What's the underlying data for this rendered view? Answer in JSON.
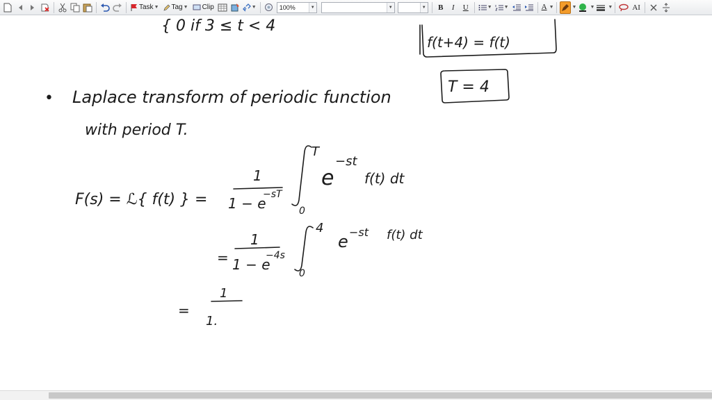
{
  "toolbar": {
    "task_label": "Task",
    "tag_label": "Tag",
    "clip_label": "Clip",
    "zoom_value": "100%",
    "font_value": "",
    "size_value": "",
    "bold_label": "B",
    "italic_label": "I",
    "underline_label": "U",
    "font_color_label": "A",
    "text_size_label": "AI"
  },
  "note": {
    "line_piece": "{ 0    if   3 ≤ t < 4",
    "box_periodic": "f(t+4) = f(t)",
    "bullet": "•",
    "heading": "Laplace transform of periodic function",
    "heading2": "with period T.",
    "box_period": "T = 4",
    "eq1_lhs": "F(s) = ℒ{ f(t) } =",
    "eq1_num": "1",
    "eq1_den": "1 − e",
    "eq1_den_exp": "−sT",
    "eq1_int_upper": "T",
    "eq1_int_lower": "0",
    "eq1_integrand": "e",
    "eq1_integrand_exp": "−st",
    "eq1_integrand_rest": "f(t) dt",
    "eq2_eq": "=",
    "eq2_num": "1",
    "eq2_den": "1 − e",
    "eq2_den_exp": "−4s",
    "eq2_int_upper": "4",
    "eq2_int_lower": "0",
    "eq2_integrand": "e",
    "eq2_integrand_exp": "−st",
    "eq2_integrand_rest": "f(t) dt",
    "eq3_eq": "=",
    "eq3_num": "1",
    "eq3_den": "1."
  }
}
